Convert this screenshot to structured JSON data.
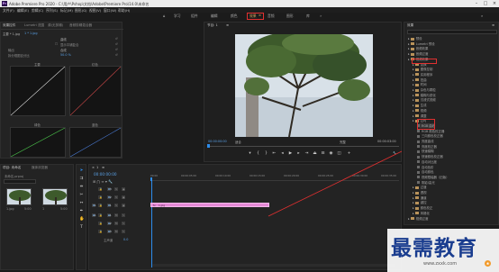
{
  "title_bar": {
    "title": "Adobe Premiere Pro 2020 - C:\\用户\\Pshop\\文档\\Adobe\\Premiere Pro\\14.0\\未命名",
    "app_icon": "Pr"
  },
  "menu": [
    "文件(F)",
    "编辑(E)",
    "剪辑(C)",
    "序列(S)",
    "标记(M)",
    "图形(G)",
    "视图(V)",
    "窗口(W)",
    "帮助(H)"
  ],
  "workspaces": [
    "学习",
    "组件",
    "编辑",
    "颜色",
    "效果",
    "音频",
    "图形",
    "库"
  ],
  "workspace_active": "效果",
  "effect_controls": {
    "tabs": [
      "效果控件",
      "Lumetri 范围",
      "源(无剪辑)",
      "音频剪辑混合器"
    ],
    "clip_label": "主要 * 1.jpg",
    "sequence_label": "1 * 1.jpg",
    "row_blend": "曲线",
    "row_show": "显示平铺复合",
    "row_output_label": "输出",
    "row_output_value": "合成",
    "row_split_label": "拆分视图百分比",
    "row_split_value": "50.0 %",
    "graphs": [
      "主要",
      "红色",
      "绿色",
      "蓝色"
    ]
  },
  "program_monitor": {
    "title": "节目: 1",
    "timecode_left": "00:00:00:00",
    "fit_label": "适合",
    "quality_label": "完整",
    "timecode_right": "00:00:03:00"
  },
  "effects_panel": {
    "title": "效果",
    "items": [
      {
        "label": "预设",
        "kind": "folder",
        "indent": 0
      },
      {
        "label": "Lumetri 预设",
        "kind": "folder",
        "indent": 0
      },
      {
        "label": "音频效果",
        "kind": "folder",
        "indent": 0
      },
      {
        "label": "音频过渡",
        "kind": "folder",
        "indent": 0
      },
      {
        "label": "视频效果",
        "kind": "folder",
        "indent": 0
      },
      {
        "label": "变换",
        "kind": "folder",
        "indent": 1
      },
      {
        "label": "图像控制",
        "kind": "folder",
        "indent": 1
      },
      {
        "label": "实用程序",
        "kind": "folder",
        "indent": 1
      },
      {
        "label": "扭曲",
        "kind": "folder",
        "indent": 1
      },
      {
        "label": "时间",
        "kind": "folder",
        "indent": 1
      },
      {
        "label": "杂色与颗粒",
        "kind": "folder",
        "indent": 1
      },
      {
        "label": "模糊与锐化",
        "kind": "folder",
        "indent": 1
      },
      {
        "label": "沉浸式视频",
        "kind": "folder",
        "indent": 1
      },
      {
        "label": "生成",
        "kind": "folder",
        "indent": 1
      },
      {
        "label": "视频",
        "kind": "folder",
        "indent": 1
      },
      {
        "label": "调整",
        "kind": "folder",
        "indent": 1
      },
      {
        "label": "过时",
        "kind": "folder",
        "indent": 1
      },
      {
        "label": "RGB 曲线",
        "kind": "fx",
        "indent": 2
      },
      {
        "label": "RGB 颜色校正器",
        "kind": "fx",
        "indent": 2
      },
      {
        "label": "三向颜色校正器",
        "kind": "fx",
        "indent": 2
      },
      {
        "label": "亮度曲线",
        "kind": "fx",
        "indent": 2
      },
      {
        "label": "亮度校正器",
        "kind": "fx",
        "indent": 2
      },
      {
        "label": "快速模糊",
        "kind": "fx",
        "indent": 2
      },
      {
        "label": "快速颜色校正器",
        "kind": "fx",
        "indent": 2
      },
      {
        "label": "自动对比度",
        "kind": "fx",
        "indent": 2
      },
      {
        "label": "自动色阶",
        "kind": "fx",
        "indent": 2
      },
      {
        "label": "自动颜色",
        "kind": "fx",
        "indent": 2
      },
      {
        "label": "视频限幅器（旧版）",
        "kind": "fx",
        "indent": 2
      },
      {
        "label": "阴影/高光",
        "kind": "fx",
        "indent": 2
      },
      {
        "label": "过渡",
        "kind": "folder",
        "indent": 1
      },
      {
        "label": "透视",
        "kind": "folder",
        "indent": 1
      },
      {
        "label": "通道",
        "kind": "folder",
        "indent": 1
      },
      {
        "label": "键控",
        "kind": "folder",
        "indent": 1
      },
      {
        "label": "颜色校正",
        "kind": "folder",
        "indent": 1
      },
      {
        "label": "风格化",
        "kind": "folder",
        "indent": 1
      },
      {
        "label": "视频过渡",
        "kind": "folder",
        "indent": 0
      }
    ]
  },
  "project_panel": {
    "tabs": [
      "项目: 未命名",
      "媒体浏览器"
    ],
    "file_label": "未命名.prproj",
    "clips": [
      {
        "name": "1.jpg",
        "duration": "5:00"
      },
      {
        "name": "1",
        "duration": "5:00"
      }
    ]
  },
  "timeline": {
    "title": "1",
    "timecode": "00:00:00:00",
    "ruler": [
      "00:00",
      "00:00:05:00",
      "00:00:10:00",
      "00:00:15:00",
      "00:00:20:00",
      "00:00:25:00",
      "00:00:30:00",
      "00:00:35:00"
    ],
    "video_tracks": [
      "V3",
      "V2",
      "V1"
    ],
    "audio_tracks": [
      "A1",
      "A2",
      "A3"
    ],
    "master_label": "主声道",
    "master_value": "0.0",
    "clip_label": "1.jpg",
    "clip_fx": "fx"
  },
  "watermark": {
    "text": "最需教育",
    "url": "www.zxxk.com"
  },
  "colors": {
    "accent_blue": "#2d8ceb",
    "clip_pink": "#e58ad6",
    "annotation_red": "#e03030",
    "active_workspace": "#d9a25b"
  }
}
